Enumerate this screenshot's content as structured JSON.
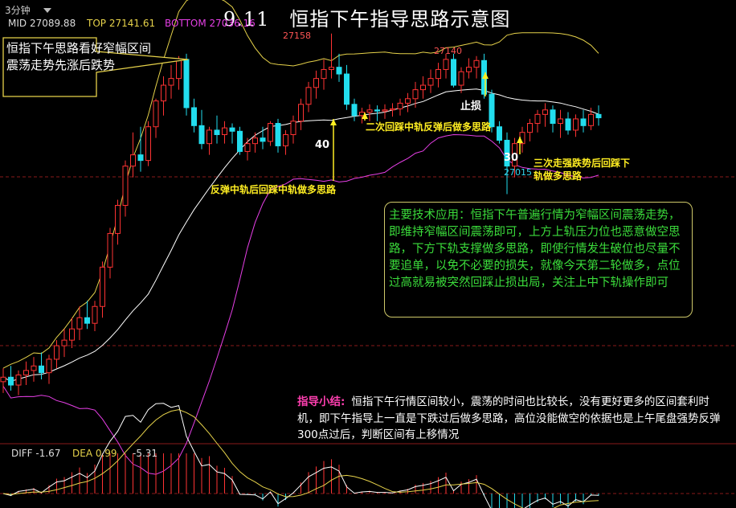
{
  "header": {
    "period": "3分钟",
    "title": "9.11　恒指下午指导思路示意图"
  },
  "legend": {
    "mid": "MID 27089.88",
    "top": "TOP 27141.61",
    "bottom": "BOTTOM 27036.16"
  },
  "callout": {
    "text": "恒指下午思路看好窄幅区间震荡走势先涨后跌势"
  },
  "annotations": {
    "high": "27158",
    "high2": "27140",
    "low": "27015",
    "label_40": "40",
    "label_30": "30",
    "stop": "止损",
    "note1": "反弹中轨后回踩中轨做多思路",
    "note2": "二次回踩中轨反弹后做多思路",
    "note3a": "三次走强跌势后回踩下",
    "note3b": "轨做多思路"
  },
  "info_box": {
    "text": "主要技术应用：恒指下午普遍行情为窄幅区间震荡走势，即维持窄幅区间震荡即可，上方上轨压力位也恶意做空思路，下方下轨支撑做多思路，即使行情发生破位也尽量不要追单，以免不必要的损失，就像今天第二轮做多，点位过高就易被突然回踩止损出局，关注上中下轨操作即可"
  },
  "summary": {
    "head": "指导小结:",
    "text": "恒指下午行情区间较小，震荡的时间也比较长，没有更好更多的区间套利时机，即下午指导上一直是下跌过后做多思路，高位没能做空的依据也是上午尾盘强势反弹300点过后，判断区间有上移情况"
  },
  "macd": {
    "diff": "DIFF -1.67",
    "dea": "DEA 0.99",
    "macd": "-5.31"
  },
  "colors": {
    "up": "#ff3333",
    "down": "#22ddee",
    "mid_line": "#ffffff",
    "top_line": "#e6d24a",
    "bottom_line": "#e63fe6",
    "annotation": "#ffee22",
    "info_text": "#3bdc3b"
  },
  "chart_data": {
    "type": "candlestick",
    "title": "9.11　恒指下午指导思路示意图",
    "interval": "3分钟",
    "y_range": [
      26830,
      27175
    ],
    "ohlc": [
      [
        26848,
        26860,
        26838,
        26852
      ],
      [
        26852,
        26862,
        26840,
        26845
      ],
      [
        26845,
        26858,
        26836,
        26854
      ],
      [
        26854,
        26866,
        26845,
        26858
      ],
      [
        26858,
        26870,
        26848,
        26862
      ],
      [
        26862,
        26874,
        26850,
        26856
      ],
      [
        26856,
        26872,
        26846,
        26868
      ],
      [
        26868,
        26885,
        26860,
        26880
      ],
      [
        26880,
        26895,
        26870,
        26885
      ],
      [
        26885,
        26905,
        26878,
        26895
      ],
      [
        26895,
        26915,
        26885,
        26905
      ],
      [
        26905,
        26920,
        26895,
        26900
      ],
      [
        26900,
        26920,
        26893,
        26915
      ],
      [
        26915,
        26955,
        26905,
        26950
      ],
      [
        26950,
        26985,
        26940,
        26980
      ],
      [
        26980,
        27010,
        26970,
        27005
      ],
      [
        27005,
        27045,
        26995,
        27040
      ],
      [
        27040,
        27070,
        27030,
        27050
      ],
      [
        27050,
        27075,
        27035,
        27045
      ],
      [
        27045,
        27080,
        27040,
        27075
      ],
      [
        27075,
        27100,
        27065,
        27098
      ],
      [
        27098,
        27120,
        27085,
        27112
      ],
      [
        27112,
        27130,
        27100,
        27118
      ],
      [
        27118,
        27138,
        27108,
        27135
      ],
      [
        27135,
        27140,
        27085,
        27092
      ],
      [
        27092,
        27100,
        27070,
        27076
      ],
      [
        27076,
        27090,
        27055,
        27060
      ],
      [
        27060,
        27075,
        27050,
        27072
      ],
      [
        27072,
        27085,
        27060,
        27068
      ],
      [
        27068,
        27080,
        27060,
        27074
      ],
      [
        27074,
        27078,
        27060,
        27071
      ],
      [
        27071,
        27075,
        27050,
        27053
      ],
      [
        27053,
        27065,
        27045,
        27060
      ],
      [
        27060,
        27070,
        27052,
        27065
      ],
      [
        27065,
        27075,
        27055,
        27062
      ],
      [
        27062,
        27080,
        27058,
        27078
      ],
      [
        27078,
        27082,
        27052,
        27058
      ],
      [
        27058,
        27072,
        27050,
        27068
      ],
      [
        27068,
        27085,
        27060,
        27080
      ],
      [
        27080,
        27100,
        27072,
        27095
      ],
      [
        27095,
        27115,
        27088,
        27110
      ],
      [
        27110,
        27125,
        27100,
        27118
      ],
      [
        27118,
        27135,
        27108,
        27126
      ],
      [
        27126,
        27158,
        27118,
        27128
      ],
      [
        27128,
        27140,
        27115,
        27122
      ],
      [
        27122,
        27130,
        27090,
        27095
      ],
      [
        27095,
        27100,
        27080,
        27085
      ],
      [
        27085,
        27092,
        27078,
        27088
      ],
      [
        27088,
        27095,
        27080,
        27090
      ],
      [
        27090,
        27094,
        27080,
        27089
      ],
      [
        27089,
        27095,
        27082,
        27090
      ],
      [
        27090,
        27096,
        27084,
        27091
      ],
      [
        27091,
        27100,
        27085,
        27096
      ],
      [
        27096,
        27105,
        27088,
        27100
      ],
      [
        27100,
        27115,
        27092,
        27108
      ],
      [
        27108,
        27120,
        27100,
        27112
      ],
      [
        27112,
        27126,
        27105,
        27118
      ],
      [
        27118,
        27132,
        27110,
        27126
      ],
      [
        27126,
        27140,
        27118,
        27135
      ],
      [
        27135,
        27140,
        27110,
        27112
      ],
      [
        27112,
        27128,
        27105,
        27124
      ],
      [
        27124,
        27136,
        27118,
        27128
      ],
      [
        27128,
        27138,
        27118,
        27134
      ],
      [
        27134,
        27140,
        27100,
        27104
      ],
      [
        27104,
        27108,
        27070,
        27075
      ],
      [
        27075,
        27080,
        27060,
        27063
      ],
      [
        27063,
        27070,
        27015,
        27040
      ],
      [
        27040,
        27065,
        27030,
        27060
      ],
      [
        27060,
        27075,
        27052,
        27070
      ],
      [
        27070,
        27082,
        27062,
        27078
      ],
      [
        27078,
        27090,
        27070,
        27086
      ],
      [
        27086,
        27096,
        27075,
        27090
      ],
      [
        27090,
        27094,
        27070,
        27078
      ],
      [
        27078,
        27090,
        27065,
        27082
      ],
      [
        27082,
        27088,
        27068,
        27072
      ],
      [
        27072,
        27086,
        27066,
        27082
      ],
      [
        27082,
        27090,
        27070,
        27076
      ],
      [
        27076,
        27092,
        27072,
        27086
      ],
      [
        27086,
        27094,
        27076,
        27083
      ]
    ]
  }
}
